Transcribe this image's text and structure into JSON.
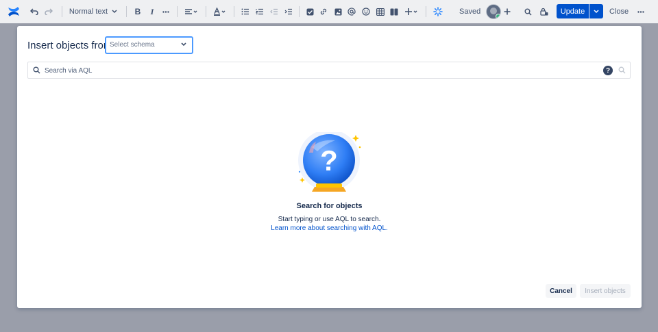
{
  "toolbar": {
    "text_style": "Normal text",
    "saved_label": "Saved",
    "update_label": "Update",
    "close_label": "Close",
    "icons": [
      "confluence-logo",
      "undo",
      "redo",
      "text-style",
      "bold",
      "italic",
      "more",
      "align",
      "text-color",
      "bullet-list",
      "numbered-list",
      "outdent",
      "indent",
      "task",
      "link",
      "image",
      "mention",
      "emoji",
      "table",
      "layout",
      "insert",
      "loading",
      "avatar",
      "invite",
      "find",
      "restrictions",
      "update-options",
      "more-actions"
    ]
  },
  "modal": {
    "title": "Insert objects from",
    "schema_placeholder": "Select schema",
    "search_placeholder": "Search via AQL",
    "help_glyph": "?",
    "empty_title": "Search for objects",
    "empty_desc": "Start typing or use AQL to search.",
    "empty_link": "Learn more about searching with AQL.",
    "cancel_label": "Cancel",
    "insert_label": "Insert objects"
  },
  "colors": {
    "primary": "#0052cc",
    "focus_border": "#4c9aff",
    "overlay": "#9a9eaa",
    "toolbar_bg": "#eff0f2",
    "text": "#172b4d"
  }
}
